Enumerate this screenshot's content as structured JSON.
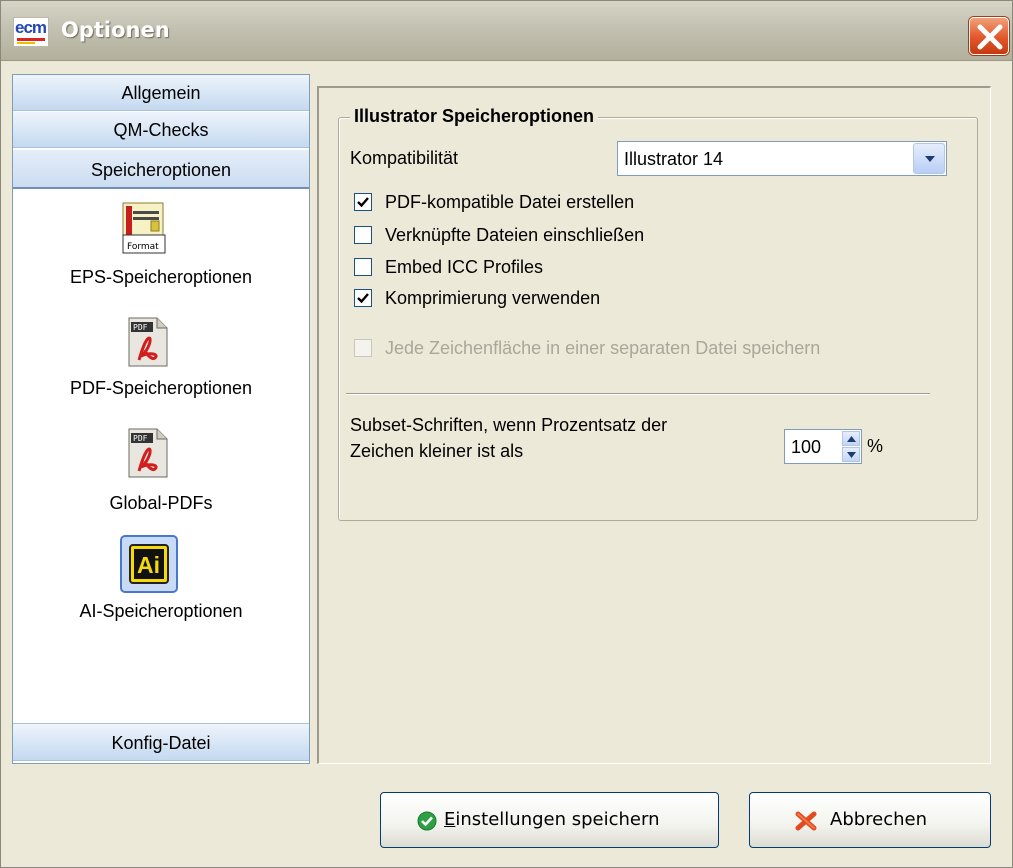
{
  "window": {
    "title": "Optionen",
    "app_icon_text": "ecm"
  },
  "nav": {
    "tabs": [
      {
        "label": "Allgemein"
      },
      {
        "label": "QM-Checks"
      },
      {
        "label": "Speicheroptionen"
      }
    ],
    "items": [
      {
        "label": "EPS-Speicheroptionen",
        "icon": "eps-format-icon",
        "icon_text": "Format"
      },
      {
        "label": "PDF-Speicheroptionen",
        "icon": "pdf-file-icon",
        "icon_text": "PDF"
      },
      {
        "label": "Global-PDFs",
        "icon": "pdf-file-icon",
        "icon_text": "PDF"
      },
      {
        "label": "AI-Speicheroptionen",
        "icon": "illustrator-icon",
        "icon_text": "Ai",
        "selected": true
      }
    ],
    "bottom_tab": {
      "label": "Konfig-Datei"
    }
  },
  "group": {
    "title": "Illustrator Speicheroptionen",
    "compatibility_label": "Kompatibilität",
    "compatibility_value": "Illustrator 14",
    "checkboxes": [
      {
        "label": "PDF-kompatible Datei erstellen",
        "checked": true,
        "enabled": true
      },
      {
        "label": "Verknüpfte Dateien einschließen",
        "checked": false,
        "enabled": true
      },
      {
        "label": "Embed ICC Profiles",
        "checked": false,
        "enabled": true
      },
      {
        "label": "Komprimierung verwenden",
        "checked": true,
        "enabled": true
      },
      {
        "label": "Jede Zeichenfläche in einer separaten Datei speichern",
        "checked": false,
        "enabled": false
      }
    ],
    "subset_label_line1": "Subset-Schriften, wenn Prozentsatz der",
    "subset_label_line2": "Zeichen kleiner ist als",
    "subset_value": "100",
    "subset_unit": "%"
  },
  "buttons": {
    "save_accel": "E",
    "save_rest": "instellungen speichern",
    "cancel": "Abbrechen"
  },
  "colors": {
    "close": "#e2562a",
    "nav_tab": "#c4d9f0",
    "save_icon": "#2ea043",
    "cancel_icon": "#e24a1f"
  }
}
